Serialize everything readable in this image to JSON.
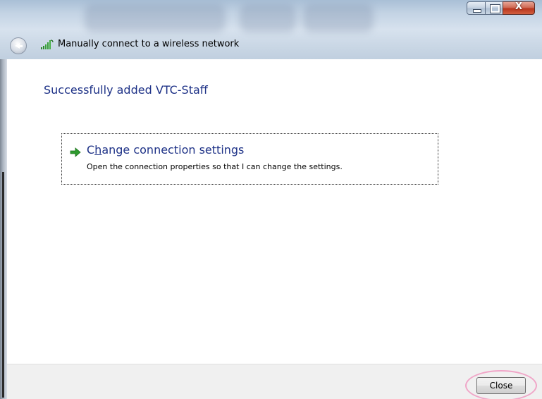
{
  "window": {
    "title": "Manually connect to a wireless network",
    "controls": {
      "minimize_icon": "minimize-icon",
      "maximize_icon": "maximize-icon",
      "close_glyph": "X"
    }
  },
  "main": {
    "heading": "Successfully added VTC-Staff",
    "task": {
      "title_prefix": "C",
      "title_access_key": "h",
      "title_rest": "ange connection settings",
      "description": "Open the connection properties so that I can change the settings.",
      "icon": "green-arrow-icon"
    }
  },
  "footer": {
    "close_label": "Close"
  },
  "colors": {
    "heading": "#1e3287",
    "highlight_ring": "#f0a6c8",
    "arrow": "#2e9b2e"
  }
}
